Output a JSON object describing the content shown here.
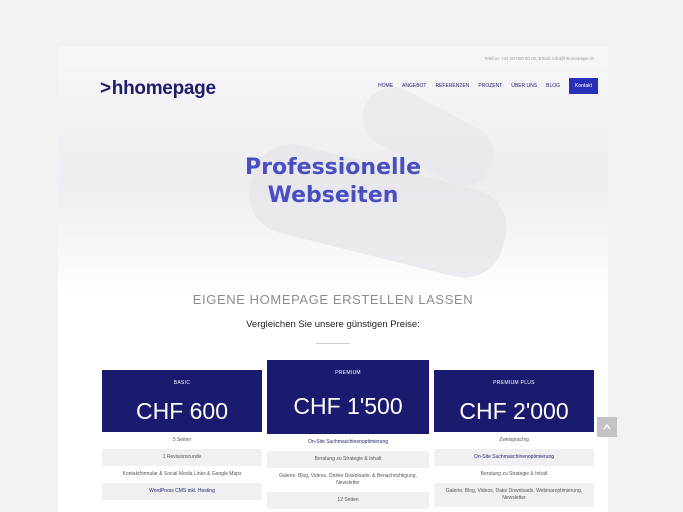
{
  "topbar": {
    "contact": "Telefon: +41 00 000 00 00, Email: info@hhomepage.ch"
  },
  "logo": {
    "chevron": ">",
    "text": "hhomepage"
  },
  "nav": {
    "items": [
      "Home",
      "Angebot",
      "Referenzen",
      "Prozent",
      "Über uns",
      "Blog"
    ],
    "cta": "Kontakt"
  },
  "hero": {
    "line1": "Professionelle",
    "line2": "Webseiten"
  },
  "section": {
    "heading": "EIGENE HOMEPAGE ERSTELLEN LASSEN",
    "subheading": "Vergleichen Sie unsere günstigen Preise:"
  },
  "plans": [
    {
      "name": "Basic",
      "price": "CHF 600",
      "features": [
        "5 Seiten",
        "1 Revisionsrunde",
        "Kontaktformular & Social Media Links & Google Maps",
        "WordPress CMS inkl. Hosting"
      ]
    },
    {
      "name": "Premium",
      "price": "CHF 1'500",
      "features": [
        "On-Site Suchmaschinenoptimierung",
        "Beratung zu Strategie & Inhalt",
        "Galerie, Blog, Videos, Online Downloads, & Benachrichtigung, Newsletter",
        "12 Seiten"
      ]
    },
    {
      "name": "Premium Plus",
      "price": "CHF 2'000",
      "features": [
        "Zweisprachig",
        "On-Site Suchmaschinenoptimierung",
        "Beratung zu Strategie & Inhalt",
        "Galerie, Blog, Videos, Datei Downloads, Webinaroptimierung, Newsletter"
      ]
    }
  ],
  "colors": {
    "brand_navy": "#1a1a6e",
    "accent_blue": "#2a2fb7",
    "hero_text": "#4a4ec0"
  },
  "icons": {
    "scroll_top": "chevron-up-icon"
  }
}
